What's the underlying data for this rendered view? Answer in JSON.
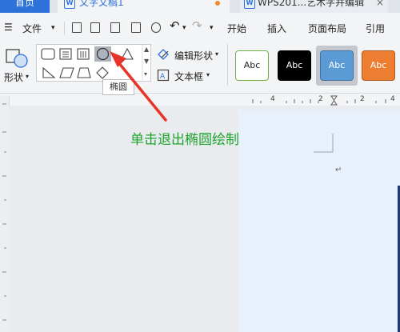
{
  "tabs": [
    {
      "label": "首页"
    },
    {
      "label": "文字文稿1"
    },
    {
      "label": "WPS201...艺术字并编辑"
    }
  ],
  "tab_close": "×",
  "menu": {
    "file_label": "文件",
    "items": [
      "开始",
      "插入",
      "页面布局",
      "引用"
    ]
  },
  "ribbon": {
    "shapes_label": "形状",
    "edit_shape_label": "编辑形状",
    "textbox_label": "文本框",
    "tooltip": "椭圆",
    "styles": [
      "Abc",
      "Abc",
      "Abc",
      "Abc"
    ]
  },
  "annotation": "单击退出椭圆绘制",
  "ruler_top": [
    "4",
    "2",
    "2",
    "4"
  ],
  "paragraph_mark": "↵",
  "colors": {
    "tab_active": "#2d72d9",
    "annotation": "#1fa52e",
    "arrow": "#e8332a",
    "style_blue": "#5b9bd5",
    "style_orange": "#ed7d31"
  }
}
